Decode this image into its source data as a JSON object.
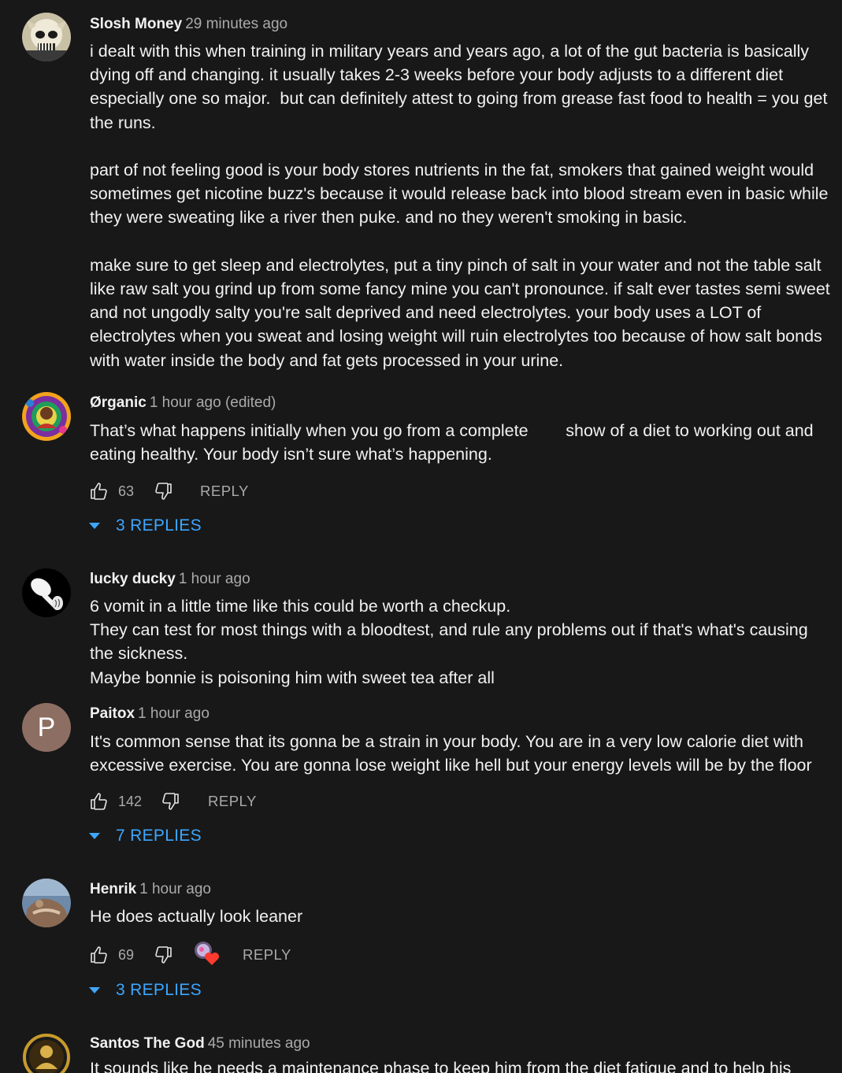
{
  "comments": [
    {
      "author": "Slosh Money",
      "time": "29 minutes ago",
      "avatar_icon": "skull-avatar-icon",
      "text": "i dealt with this when training in military years and years ago, a lot of the gut bacteria is basically dying off and changing. it usually takes 2-3 weeks before your body adjusts to a different diet especially one so major.  but can definitely attest to going from grease fast food to health = you get the runs.\n\npart of not feeling good is your body stores nutrients in the fat, smokers that gained weight would sometimes get nicotine buzz's because it would release back into blood stream even in basic while they were sweating like a river then puke. and no they weren't smoking in basic.\n\nmake sure to get sleep and electrolytes, put a tiny pinch of salt in your water and not the table salt like raw salt you grind up from some fancy mine you can't pronounce. if salt ever tastes semi sweet and not ungodly salty you're salt deprived and need electrolytes. your body uses a LOT of electrolytes when you sweat and losing weight will ruin electrolytes too because of how salt bonds with water inside the body and fat gets processed in your urine."
    },
    {
      "author": "Ørganic",
      "time": "1 hour ago (edited)",
      "avatar_icon": "psychedelic-avatar-icon",
      "text": "That’s what happens initially when you go from a complete        show of a diet to working out and eating healthy. Your body isn’t sure what’s happening.",
      "likes": "63",
      "reply_label": "REPLY",
      "replies_label": "3 REPLIES"
    },
    {
      "author": "lucky ducky",
      "time": "1 hour ago",
      "avatar_icon": "spoon-avatar-icon",
      "text": "6 vomit in a little time like this could be worth a checkup.\nThey can test for most things with a bloodtest, and rule any problems out if that's what's causing the sickness.\nMaybe bonnie is poisoning him with sweet tea after all"
    },
    {
      "author": "Paitox",
      "time": "1 hour ago",
      "avatar_letter": "P",
      "avatar_color": "#8d6e63",
      "text": "It's common sense that its gonna be a strain in your body. You are in a very low calorie diet with excessive exercise. You are gonna lose weight like hell but your energy levels will be by the floor",
      "likes": "142",
      "reply_label": "REPLY",
      "replies_label": "7 REPLIES"
    },
    {
      "author": "Henrik",
      "time": "1 hour ago",
      "avatar_icon": "photo-avatar-icon",
      "text": "He does actually look leaner",
      "likes": "69",
      "creator_heart_icon": "creator-heart-icon",
      "reply_label": "REPLY",
      "replies_label": "3 REPLIES"
    },
    {
      "author": "Santos The God",
      "time": "45 minutes ago",
      "avatar_icon": "emblem-avatar-icon",
      "text": "It sounds like he needs a maintenance phase to keep him from the diet fatigue and to help his sanity"
    }
  ],
  "colors": {
    "background": "#181818",
    "text": "#f1f1f1",
    "secondary": "#aaaaaa",
    "link": "#3ea6ff"
  }
}
